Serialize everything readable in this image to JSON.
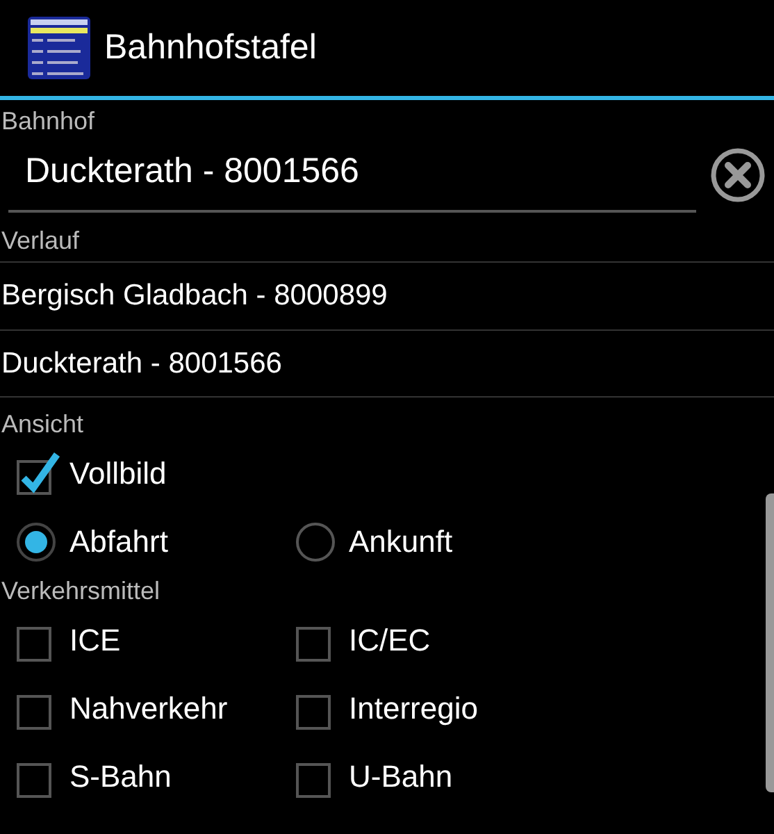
{
  "window": {
    "title": "Bahnhofstafel"
  },
  "station": {
    "label": "Bahnhof",
    "value": "Duckterath - 8001566"
  },
  "history": {
    "label": "Verlauf",
    "items": [
      {
        "text": "Bergisch Gladbach - 8000899"
      },
      {
        "text": "Duckterath - 8001566"
      }
    ]
  },
  "view": {
    "label": "Ansicht",
    "fullscreen": {
      "label": "Vollbild",
      "checked": true
    },
    "direction": [
      {
        "label": "Abfahrt",
        "selected": true
      },
      {
        "label": "Ankunft",
        "selected": false
      }
    ]
  },
  "transport": {
    "label": "Verkehrsmittel",
    "options": [
      {
        "label": "ICE",
        "checked": false
      },
      {
        "label": "IC/EC",
        "checked": false
      },
      {
        "label": "Nahverkehr",
        "checked": false
      },
      {
        "label": "Interregio",
        "checked": false
      },
      {
        "label": "S-Bahn",
        "checked": false
      },
      {
        "label": "U-Bahn",
        "checked": false
      }
    ]
  }
}
